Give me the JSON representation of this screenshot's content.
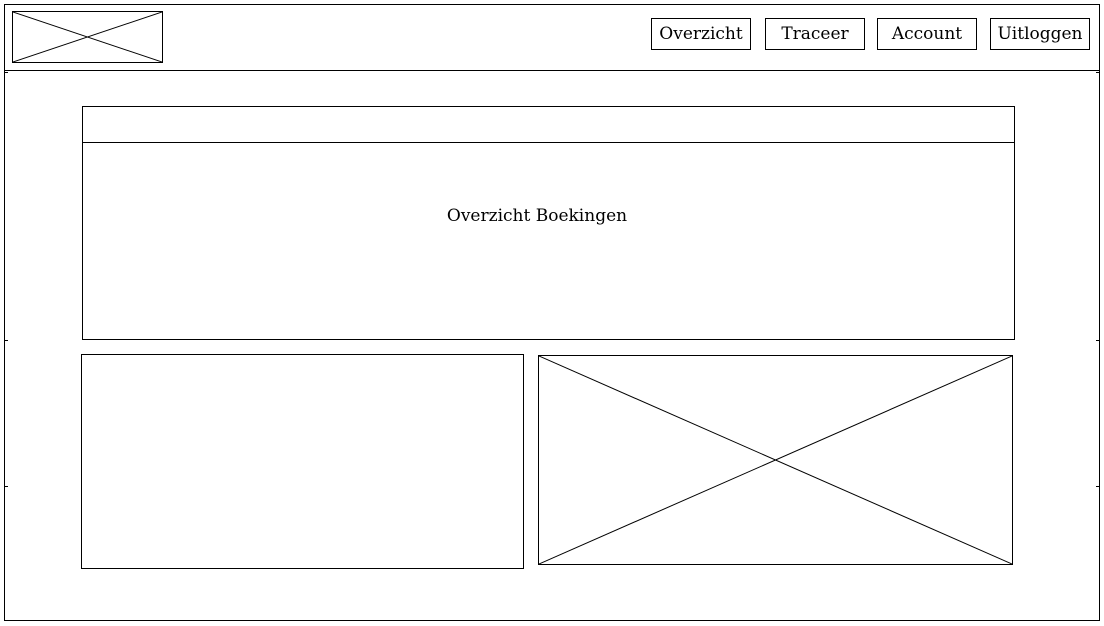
{
  "header": {
    "logo_icon": "logo-placeholder-icon",
    "nav": [
      {
        "label": "Overzicht"
      },
      {
        "label": "Traceer"
      },
      {
        "label": "Account"
      },
      {
        "label": "Uitloggen"
      }
    ]
  },
  "main": {
    "overview_title": "Overzicht Boekingen",
    "image_icon": "image-placeholder-icon"
  }
}
